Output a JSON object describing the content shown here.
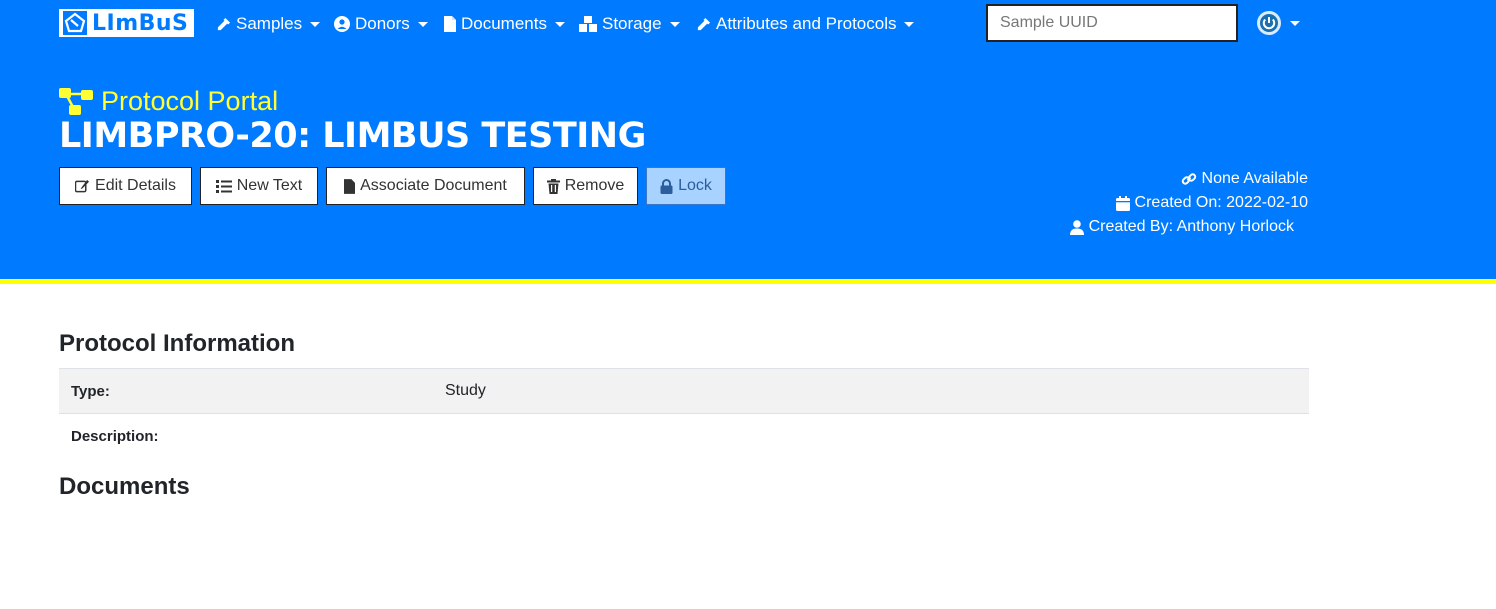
{
  "brand": {
    "name": "LImBuS"
  },
  "nav": {
    "items": [
      {
        "label": "Samples",
        "icon": "eyedropper-icon"
      },
      {
        "label": "Donors",
        "icon": "user-circle-icon"
      },
      {
        "label": "Documents",
        "icon": "file-icon"
      },
      {
        "label": "Storage",
        "icon": "boxes-icon"
      },
      {
        "label": "Attributes and Protocols",
        "icon": "eyedropper-icon"
      }
    ],
    "search_placeholder": "Sample UUID",
    "user_icon": "power-icon"
  },
  "header": {
    "portal_label": "Protocol Portal",
    "title": "LIMBPRO-20: LIMBUS TESTING",
    "buttons": {
      "edit": "Edit Details",
      "new_text": "New Text",
      "associate": "Associate Document",
      "remove": "Remove",
      "lock": "Lock"
    },
    "meta": {
      "link": "None Available",
      "created_on": "Created On: 2022-02-10",
      "created_by": "Created By: Anthony Horlock"
    }
  },
  "colors": {
    "primary": "#007bff",
    "accent": "#ffff00",
    "lock_button": "#a8d2ff"
  },
  "protocol_info": {
    "title": "Protocol Information",
    "rows": [
      {
        "label": "Type:",
        "value": "Study"
      },
      {
        "label": "Description:",
        "value": ""
      }
    ]
  },
  "documents": {
    "title": "Documents"
  }
}
